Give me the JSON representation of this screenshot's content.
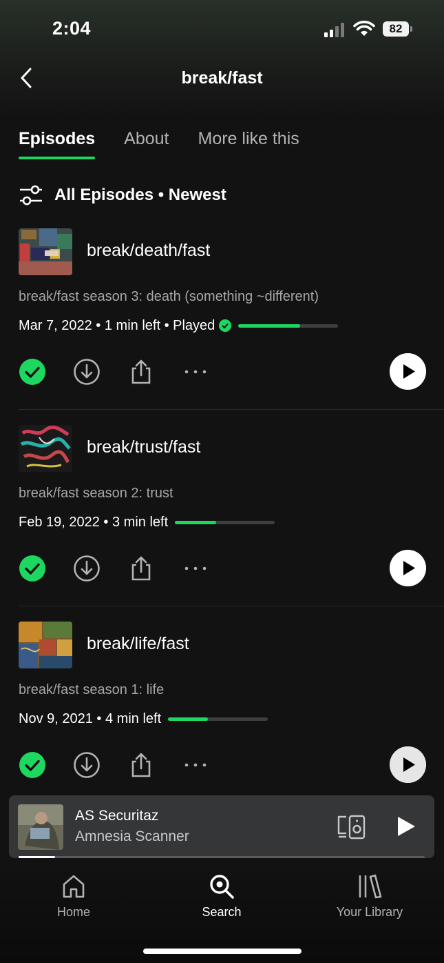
{
  "status_bar": {
    "time": "2:04",
    "battery": "82"
  },
  "header": {
    "title": "break/fast"
  },
  "tabs": [
    {
      "label": "Episodes",
      "active": true
    },
    {
      "label": "About",
      "active": false
    },
    {
      "label": "More like this",
      "active": false
    }
  ],
  "filter": {
    "label": "All Episodes • Newest"
  },
  "episodes": [
    {
      "title": "break/death/fast",
      "description": "break/fast season 3: death (something ~different)",
      "date": "Mar 7, 2022",
      "time_left": "1 min left",
      "played_label": "Played",
      "progress": 0.62
    },
    {
      "title": "break/trust/fast",
      "description": "break/fast season 2: trust",
      "date": "Feb 19, 2022",
      "time_left": "3 min left",
      "played_label": "",
      "progress": 0.41
    },
    {
      "title": "break/life/fast",
      "description": "break/fast season 1: life",
      "date": "Nov 9, 2021",
      "time_left": "4 min left",
      "played_label": "",
      "progress": 0.4
    }
  ],
  "now_playing": {
    "title": "AS Securitaz",
    "artist": "Amnesia Scanner",
    "progress": 0.09
  },
  "nav": [
    {
      "label": "Home",
      "icon": "home-icon"
    },
    {
      "label": "Search",
      "icon": "search-icon"
    },
    {
      "label": "Your Library",
      "icon": "library-icon"
    }
  ],
  "colors": {
    "accent": "#1ed760",
    "background": "#121212"
  }
}
